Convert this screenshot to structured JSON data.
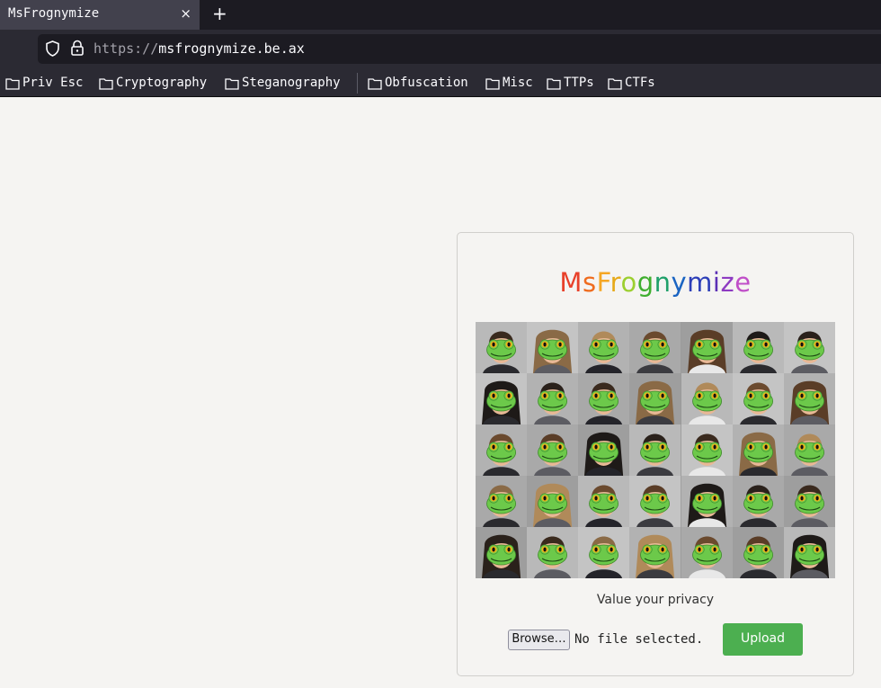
{
  "browser": {
    "tab_title": "MsFrognymize",
    "tab_close": "×",
    "new_tab": "+",
    "url_protocol": "https://",
    "url_host": "msfrognymize.be.ax",
    "bookmarks": [
      "Priv Esc",
      "Cryptography",
      "Steganography",
      "Obfuscation",
      "Misc",
      "TTPs",
      "CTFs"
    ]
  },
  "page": {
    "logo": {
      "letters": [
        "M",
        "s",
        "F",
        "r",
        "o",
        "g",
        "n",
        "y",
        "m",
        "i",
        "z",
        "e"
      ],
      "colors": [
        "#e8402a",
        "#ef6c1f",
        "#f5a623",
        "#e6a919",
        "#9ccf30",
        "#3fae2f",
        "#1fa06a",
        "#1a64c2",
        "#2d3fb8",
        "#5b30b5",
        "#8e3bc2",
        "#c04fc8"
      ]
    },
    "mosaic_image": "frog-masked-faces-grid",
    "mosaic_rows": 5,
    "mosaic_cols": 7,
    "tagline": "Value your privacy",
    "browse_label": "Browse…",
    "file_status": "No file selected.",
    "upload_label": "Upload",
    "colors": {
      "upload_bg": "#4caf50",
      "frog": "#6cc94a"
    }
  }
}
